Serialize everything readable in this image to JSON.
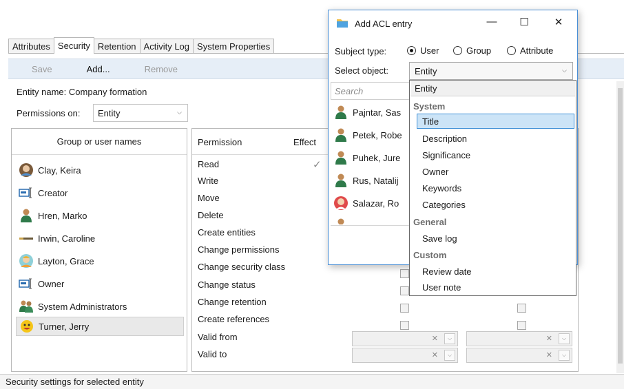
{
  "tabs": [
    "Attributes",
    "Security",
    "Retention",
    "Activity Log",
    "System Properties"
  ],
  "active_tab": "Security",
  "toolbar": {
    "save": "Save",
    "add": "Add...",
    "remove": "Remove"
  },
  "entity": {
    "label": "Entity name:",
    "value": "Company formation"
  },
  "permissions_on": {
    "label": "Permissions on:",
    "value": "Entity"
  },
  "group_panel": {
    "header": "Group or user names",
    "users": [
      {
        "name": "Clay, Keira",
        "icon": "female-avatar-icon"
      },
      {
        "name": "Creator",
        "icon": "creator-icon"
      },
      {
        "name": "Hren, Marko",
        "icon": "user-icon"
      },
      {
        "name": "Irwin, Caroline",
        "icon": "signature-icon"
      },
      {
        "name": "Layton, Grace",
        "icon": "female-avatar-icon"
      },
      {
        "name": "Owner",
        "icon": "owner-icon"
      },
      {
        "name": "System Administrators",
        "icon": "group-icon"
      },
      {
        "name": "Turner, Jerry",
        "icon": "emoji-avatar-icon"
      }
    ],
    "selected": "Turner, Jerry"
  },
  "permission_panel": {
    "header_permission": "Permission",
    "header_effective": "Effect",
    "permissions": [
      "Read",
      "Write",
      "Move",
      "Delete",
      "Create entities",
      "Change permissions",
      "Change security class",
      "Change status",
      "Change retention",
      "Create references",
      "Valid from",
      "Valid to"
    ],
    "checked_effective": "Read"
  },
  "status_bar": "Security settings for selected entity",
  "dialog": {
    "title": "Add ACL entry",
    "subject_type_label": "Subject type:",
    "subject_types": [
      "User",
      "Group",
      "Attribute"
    ],
    "subject_type_selected": "User",
    "select_object_label": "Select object:",
    "select_object_value": "Entity",
    "search_placeholder": "Search",
    "list": [
      "Pajntar, Sas",
      "Petek, Robe",
      "Puhek, Jure",
      "Rus, Natalij",
      "Salazar, Ro"
    ]
  },
  "dropdown": {
    "current": "Entity",
    "groups": [
      {
        "name": "System",
        "options": [
          "Title",
          "Description",
          "Significance",
          "Owner",
          "Keywords",
          "Categories"
        ]
      },
      {
        "name": "General",
        "options": [
          "Save log"
        ]
      },
      {
        "name": "Custom",
        "options": [
          "Review date",
          "User note"
        ]
      }
    ],
    "highlighted": "Title"
  },
  "colors": {
    "toolbar_bg": "#e6eef7",
    "dialog_border": "#4a8fd6",
    "highlight_bg": "#cce4f7",
    "highlight_border": "#3d8fd6"
  }
}
